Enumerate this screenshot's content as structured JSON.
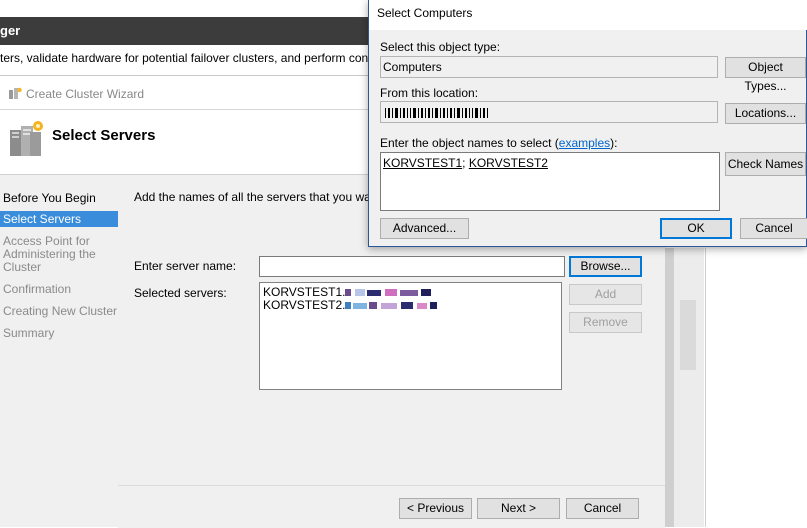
{
  "background_window": {
    "title": "ger",
    "description": "ters, validate hardware for potential failover clusters, and perform configurat"
  },
  "wizard": {
    "title": "Create Cluster Wizard",
    "heading": "Select Servers",
    "steps": [
      {
        "label": "Before You Begin",
        "state": "done"
      },
      {
        "label": "Select Servers",
        "state": "active"
      },
      {
        "label": "Access Point for",
        "state": "pending"
      },
      {
        "label": "Administering the",
        "state": "pending"
      },
      {
        "label": "Cluster",
        "state": "pending"
      },
      {
        "label": "Confirmation",
        "state": "pending"
      },
      {
        "label": "Creating New Cluster",
        "state": "pending"
      },
      {
        "label": "Summary",
        "state": "pending"
      }
    ],
    "instructions": "Add the names of all the servers that you want to h",
    "enter_server_label": "Enter server name:",
    "server_name_value": "",
    "browse_label": "Browse...",
    "selected_servers_label": "Selected servers:",
    "selected_servers": [
      "KORVSTEST1.",
      "KORVSTEST2."
    ],
    "add_label": "Add",
    "remove_label": "Remove",
    "prev_label": "< Previous",
    "next_label": "Next >",
    "cancel_label": "Cancel"
  },
  "dialog": {
    "title": "Select Computers",
    "object_type_label": "Select this object type:",
    "object_type_value": "Computers",
    "object_types_button": "Object Types...",
    "location_label": "From this location:",
    "locations_button": "Locations...",
    "names_label": "Enter the object names to select (",
    "examples_link": "examples",
    "names_label_end": "):",
    "names_value_1": "KORVSTEST1",
    "names_sep": "; ",
    "names_value_2": "KORVSTEST2",
    "check_names_button": "Check Names",
    "advanced_button": "Advanced...",
    "ok_button": "OK",
    "cancel_button": "Cancel"
  },
  "colors": {
    "selection_blue": "#3a8ddb",
    "link_blue": "#0066cc",
    "focus_border": "#0078d7"
  }
}
